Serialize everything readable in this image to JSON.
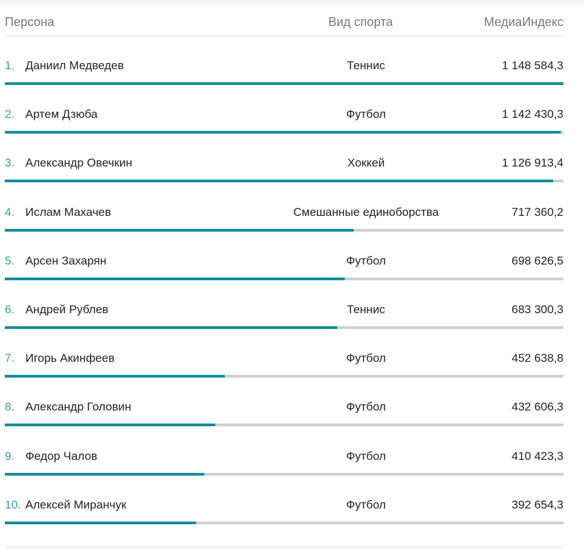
{
  "header": {
    "person": "Персона",
    "sport": "Вид спорта",
    "index": "МедиаИндекс"
  },
  "rows": [
    {
      "rank": "1.",
      "name": "Даниил Медведев",
      "sport": "Теннис",
      "index": "1 148 584,3",
      "value": 1148584.3
    },
    {
      "rank": "2.",
      "name": "Артем Дзюба",
      "sport": "Футбол",
      "index": "1 142 430,3",
      "value": 1142430.3
    },
    {
      "rank": "3.",
      "name": "Александр Овечкин",
      "sport": "Хоккей",
      "index": "1 126 913,4",
      "value": 1126913.4
    },
    {
      "rank": "4.",
      "name": "Ислам Махачев",
      "sport": "Смешанные единоборства",
      "index": "717 360,2",
      "value": 717360.2
    },
    {
      "rank": "5.",
      "name": "Арсен Захарян",
      "sport": "Футбол",
      "index": "698 626,5",
      "value": 698626.5
    },
    {
      "rank": "6.",
      "name": "Андрей Рублев",
      "sport": "Теннис",
      "index": "683 300,3",
      "value": 683300.3
    },
    {
      "rank": "7.",
      "name": "Игорь Акинфеев",
      "sport": "Футбол",
      "index": "452 638,8",
      "value": 452638.8
    },
    {
      "rank": "8.",
      "name": "Александр Головин",
      "sport": "Футбол",
      "index": "432 606,3",
      "value": 432606.3
    },
    {
      "rank": "9.",
      "name": "Федор Чалов",
      "sport": "Футбол",
      "index": "410 423,3",
      "value": 410423.3
    },
    {
      "rank": "10.",
      "name": "Алексей Миранчук",
      "sport": "Футбол",
      "index": "392 654,3",
      "value": 392654.3
    }
  ],
  "colors": {
    "accent": "#138e9c",
    "rank": "#3a9bab",
    "track": "#cfcfcf"
  }
}
